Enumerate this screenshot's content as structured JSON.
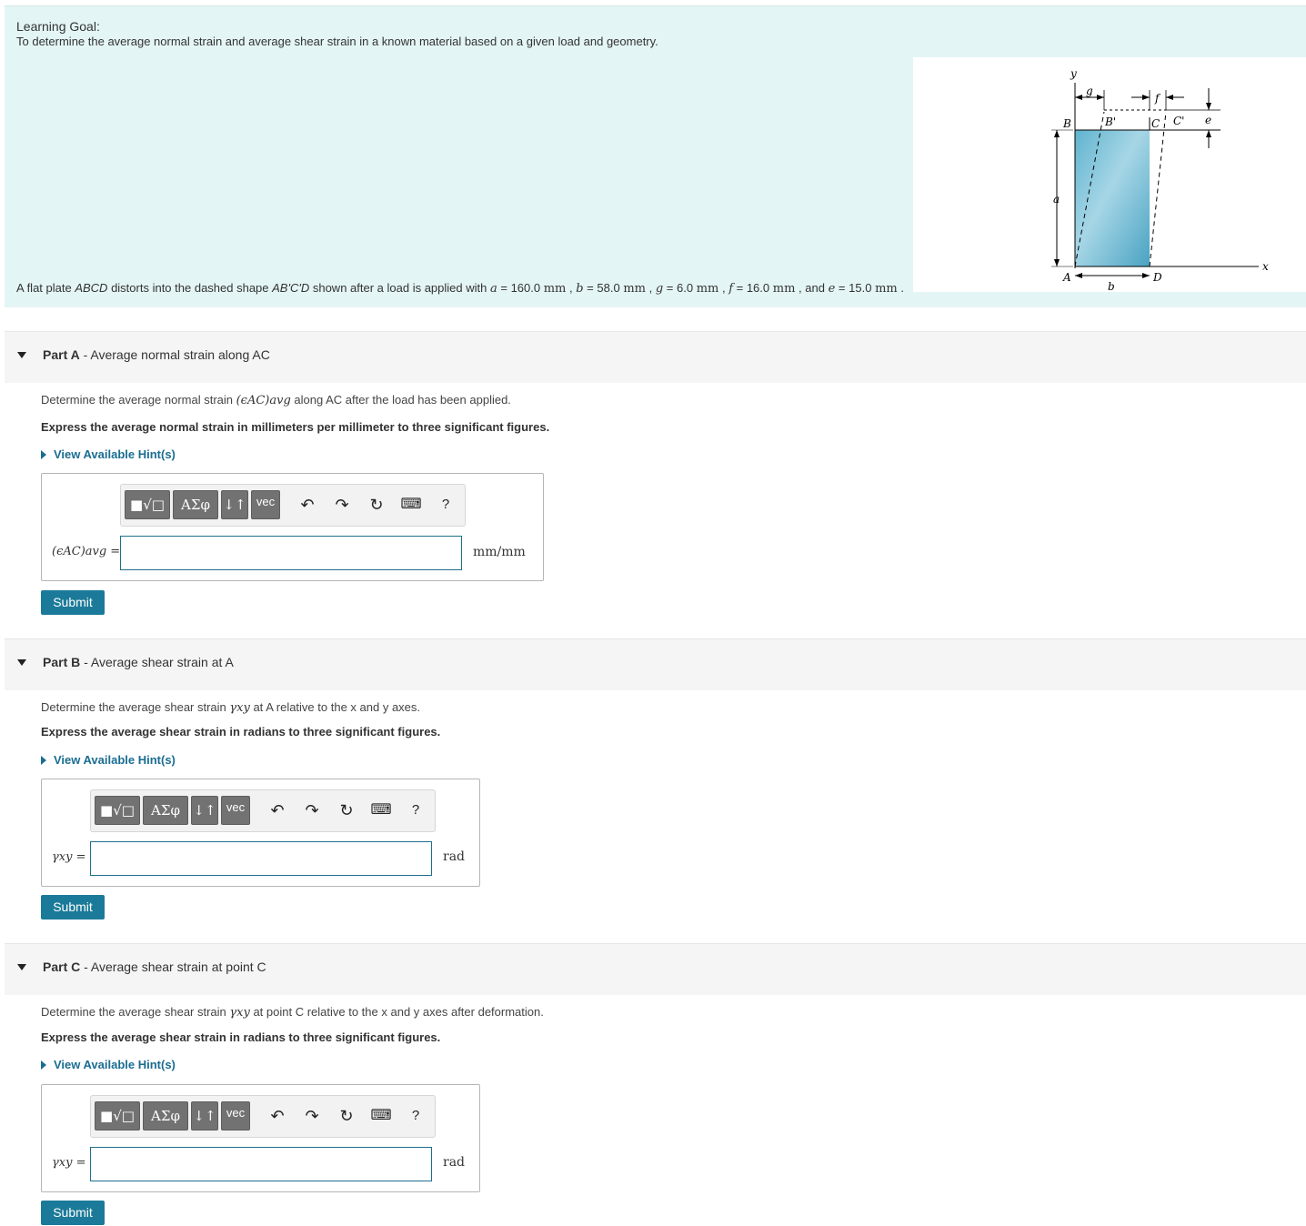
{
  "learning_goal": {
    "title": "Learning Goal:",
    "text": "To determine the average normal strain and average shear strain in a known material based on a given load and geometry."
  },
  "problem": {
    "prefix": "A flat plate ",
    "plate": "ABCD",
    "mid": " distorts into the dashed shape ",
    "shape": "AB'C'D",
    "after": " shown after a load is applied with ",
    "a_sym": "a",
    "a_val": "160.0",
    "b_sym": "b",
    "b_val": "58.0",
    "g_sym": "g",
    "g_val": "6.0",
    "f_sym": "f",
    "f_val": "16.0",
    "e_sym": "e",
    "e_val": "15.0",
    "unit": "mm",
    "and": "and"
  },
  "figure": {
    "y": "y",
    "x": "x",
    "g": "g",
    "f": "f",
    "e": "e",
    "a": "a",
    "b": "b",
    "B": "B",
    "Bp": "B'",
    "C": "C",
    "Cp": "C'",
    "A": "A",
    "D": "D"
  },
  "toolbar": {
    "templates": "■√□",
    "greek": "ΑΣφ",
    "arrows": "↓↑",
    "vec": "vec",
    "undo": "↶",
    "redo": "↷",
    "reset": "↻",
    "keyboard": "⌨",
    "help": "?"
  },
  "hint_label": "View Available Hint(s)",
  "submit_label": "Submit",
  "parts": [
    {
      "label": "Part A",
      "title": "Average normal strain along AC",
      "question_pre": "Determine the average normal strain ",
      "question_sym": "(ϵAC)avg",
      "question_post": " along AC after the load has been applied.",
      "express": "Express the average normal strain in millimeters per millimeter to three significant figures.",
      "answer_label": "(ϵAC)avg =",
      "unit": "mm/mm"
    },
    {
      "label": "Part B",
      "title": "Average shear strain at A",
      "question_pre": "Determine the average shear strain ",
      "question_sym": "γxy",
      "question_post": " at A relative to the x and y axes.",
      "express": "Express the average shear strain in radians to three significant figures.",
      "answer_label": "γxy =",
      "unit": "rad"
    },
    {
      "label": "Part C",
      "title": "Average shear strain at point C",
      "question_pre": "Determine the average shear strain ",
      "question_sym": "γxy",
      "question_post": " at point C relative to the x and y axes after deformation.",
      "express": "Express the average shear strain in radians to three significant figures.",
      "answer_label": "γxy =",
      "unit": "rad"
    }
  ]
}
